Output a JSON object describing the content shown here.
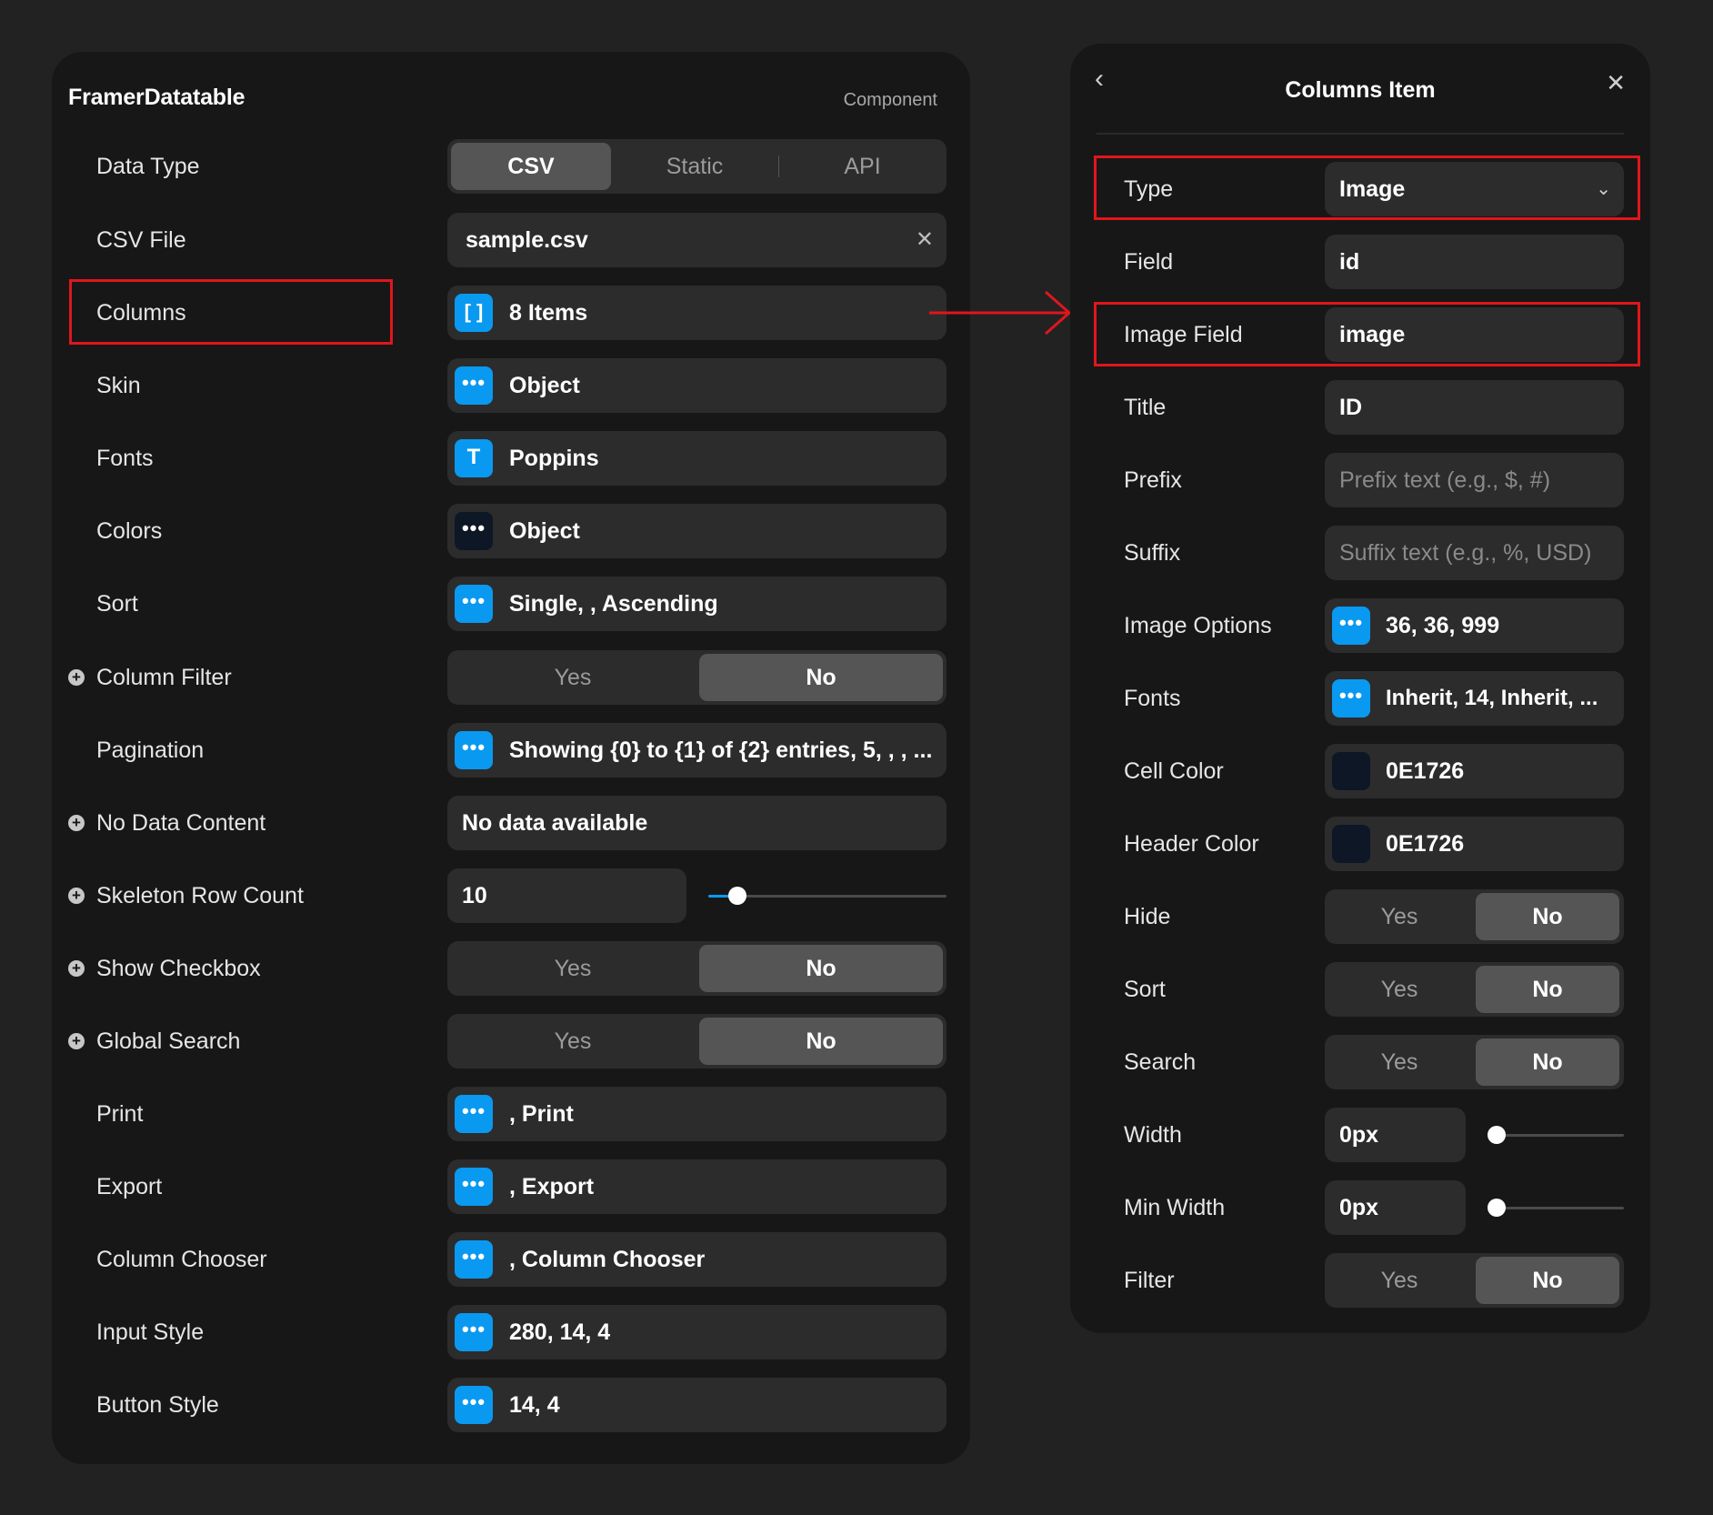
{
  "left_panel": {
    "title": "FramerDatatable",
    "kind": "Component",
    "data_type": {
      "label": "Data Type",
      "options": [
        "CSV",
        "Static",
        "API"
      ],
      "selected": "CSV"
    },
    "csv_file": {
      "label": "CSV File",
      "value": "sample.csv",
      "clear_icon": "close-icon"
    },
    "columns": {
      "label": "Columns",
      "value": "8 Items",
      "icon": "array-icon",
      "glyph": "[ ]"
    },
    "skin": {
      "label": "Skin",
      "value": "Object",
      "icon": "more-icon"
    },
    "fonts": {
      "label": "Fonts",
      "value": "Poppins",
      "icon": "text-icon",
      "glyph": "T"
    },
    "colors": {
      "label": "Colors",
      "value": "Object",
      "icon": "more-icon"
    },
    "sort": {
      "label": "Sort",
      "value": "Single, , Ascending",
      "icon": "more-icon"
    },
    "column_filter": {
      "label": "Column Filter",
      "yes": "Yes",
      "no": "No",
      "selected": "No"
    },
    "pagination": {
      "label": "Pagination",
      "value": "Showing {0} to {1} of {2} entries, 5, , , ...",
      "icon": "more-icon"
    },
    "no_data_content": {
      "label": "No Data Content",
      "value": "No data available"
    },
    "skeleton_row_count": {
      "label": "Skeleton Row Count",
      "value": "10"
    },
    "show_checkbox": {
      "label": "Show Checkbox",
      "yes": "Yes",
      "no": "No",
      "selected": "No"
    },
    "global_search": {
      "label": "Global Search",
      "yes": "Yes",
      "no": "No",
      "selected": "No"
    },
    "print": {
      "label": "Print",
      "value": ", Print",
      "icon": "more-icon"
    },
    "export": {
      "label": "Export",
      "value": ", Export",
      "icon": "more-icon"
    },
    "column_chooser": {
      "label": "Column Chooser",
      "value": ", Column Chooser",
      "icon": "more-icon"
    },
    "input_style": {
      "label": "Input Style",
      "value": "280, 14, 4",
      "icon": "more-icon"
    },
    "button_style": {
      "label": "Button Style",
      "value": "14, 4",
      "icon": "more-icon"
    },
    "more_glyph": "•••",
    "plus_glyph": "+"
  },
  "right_panel": {
    "title": "Columns Item",
    "back_glyph": "‹",
    "close_glyph": "✕",
    "type": {
      "label": "Type",
      "value": "Image",
      "chevron": "⌄"
    },
    "field": {
      "label": "Field",
      "value": "id"
    },
    "image_field": {
      "label": "Image Field",
      "value": "image"
    },
    "title_row": {
      "label": "Title",
      "value": "ID"
    },
    "prefix": {
      "label": "Prefix",
      "placeholder": "Prefix text (e.g., $, #)"
    },
    "suffix": {
      "label": "Suffix",
      "placeholder": "Suffix text (e.g., %, USD)"
    },
    "image_options": {
      "label": "Image Options",
      "value": "36, 36, 999",
      "icon": "more-icon"
    },
    "fonts": {
      "label": "Fonts",
      "value": "Inherit, 14, Inherit, ...",
      "icon": "more-icon"
    },
    "cell_color": {
      "label": "Cell Color",
      "value": "0E1726",
      "swatch": "#0E1726"
    },
    "header_color": {
      "label": "Header Color",
      "value": "0E1726",
      "swatch": "#0E1726"
    },
    "hide": {
      "label": "Hide",
      "yes": "Yes",
      "no": "No",
      "selected": "No"
    },
    "sort": {
      "label": "Sort",
      "yes": "Yes",
      "no": "No",
      "selected": "No"
    },
    "search": {
      "label": "Search",
      "yes": "Yes",
      "no": "No",
      "selected": "No"
    },
    "width": {
      "label": "Width",
      "value": "0px"
    },
    "min_width": {
      "label": "Min Width",
      "value": "0px"
    },
    "filter": {
      "label": "Filter",
      "yes": "Yes",
      "no": "No",
      "selected": "No"
    }
  },
  "colors": {
    "accent": "#0A99F0",
    "highlight": "#E0161B",
    "panel": "#171717",
    "control": "#2C2C2C"
  }
}
